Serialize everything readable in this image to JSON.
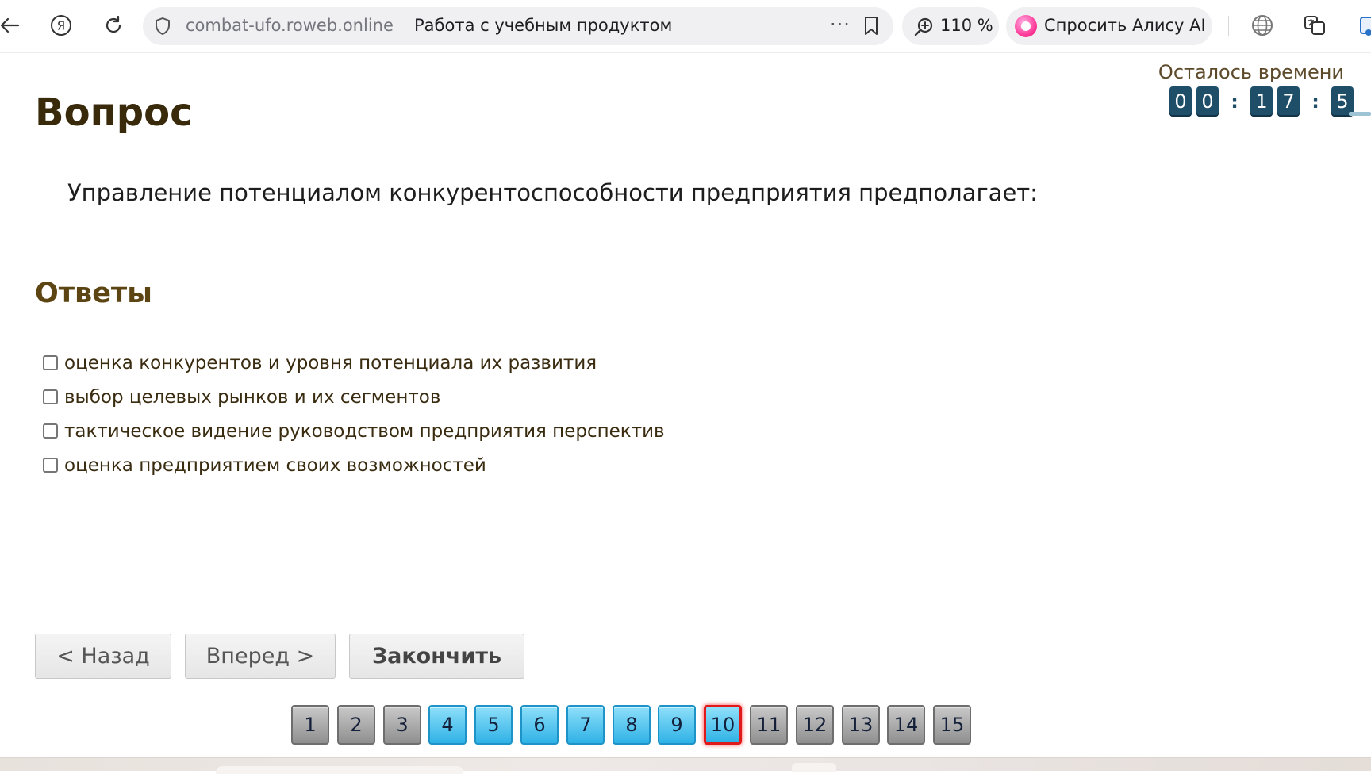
{
  "browser": {
    "url": "combat-ufo.roweb.online",
    "page_title": "Работа с учебным продуктом",
    "more_label": "···",
    "zoom": "110 %",
    "alice_label": "Спросить Алису AI",
    "icons": [
      "back-arrow-icon",
      "yandex-icon",
      "reload-icon",
      "shield-icon",
      "bookmark-icon",
      "zoom-icon",
      "alice-icon",
      "globe-icon",
      "translate-icon"
    ]
  },
  "timer": {
    "label": "Осталось времени",
    "digits": [
      "0",
      "0",
      "1",
      "7",
      "5"
    ],
    "separator": ":"
  },
  "question": {
    "heading": "Вопрос",
    "text": "Управление потенциалом конкурентоспособности предприятия предполагает:"
  },
  "answers": {
    "heading": "Ответы",
    "items": [
      {
        "label": "оценка конкурентов и уровня потенциала их развития",
        "checked": false
      },
      {
        "label": "выбор целевых рынков и их сегментов",
        "checked": false
      },
      {
        "label": "тактическое видение руководством предприятия перспектив",
        "checked": false
      },
      {
        "label": "оценка предприятием своих возможностей",
        "checked": false
      }
    ]
  },
  "navigation": {
    "back_label": "< Назад",
    "forward_label": "Вперед >",
    "finish_label": "Закончить"
  },
  "pager": {
    "pages": [
      "1",
      "2",
      "3",
      "4",
      "5",
      "6",
      "7",
      "8",
      "9",
      "10",
      "11",
      "12",
      "13",
      "14",
      "15"
    ],
    "states": [
      "visited",
      "visited",
      "visited",
      "answered",
      "answered",
      "answered",
      "answered",
      "answered",
      "answered",
      "current",
      "visited",
      "visited",
      "visited",
      "visited",
      "visited"
    ],
    "current": "10",
    "colors": {
      "visited": "#9e9e9e",
      "answered": "#3cbcec",
      "current_border": "#e01a1a"
    }
  }
}
